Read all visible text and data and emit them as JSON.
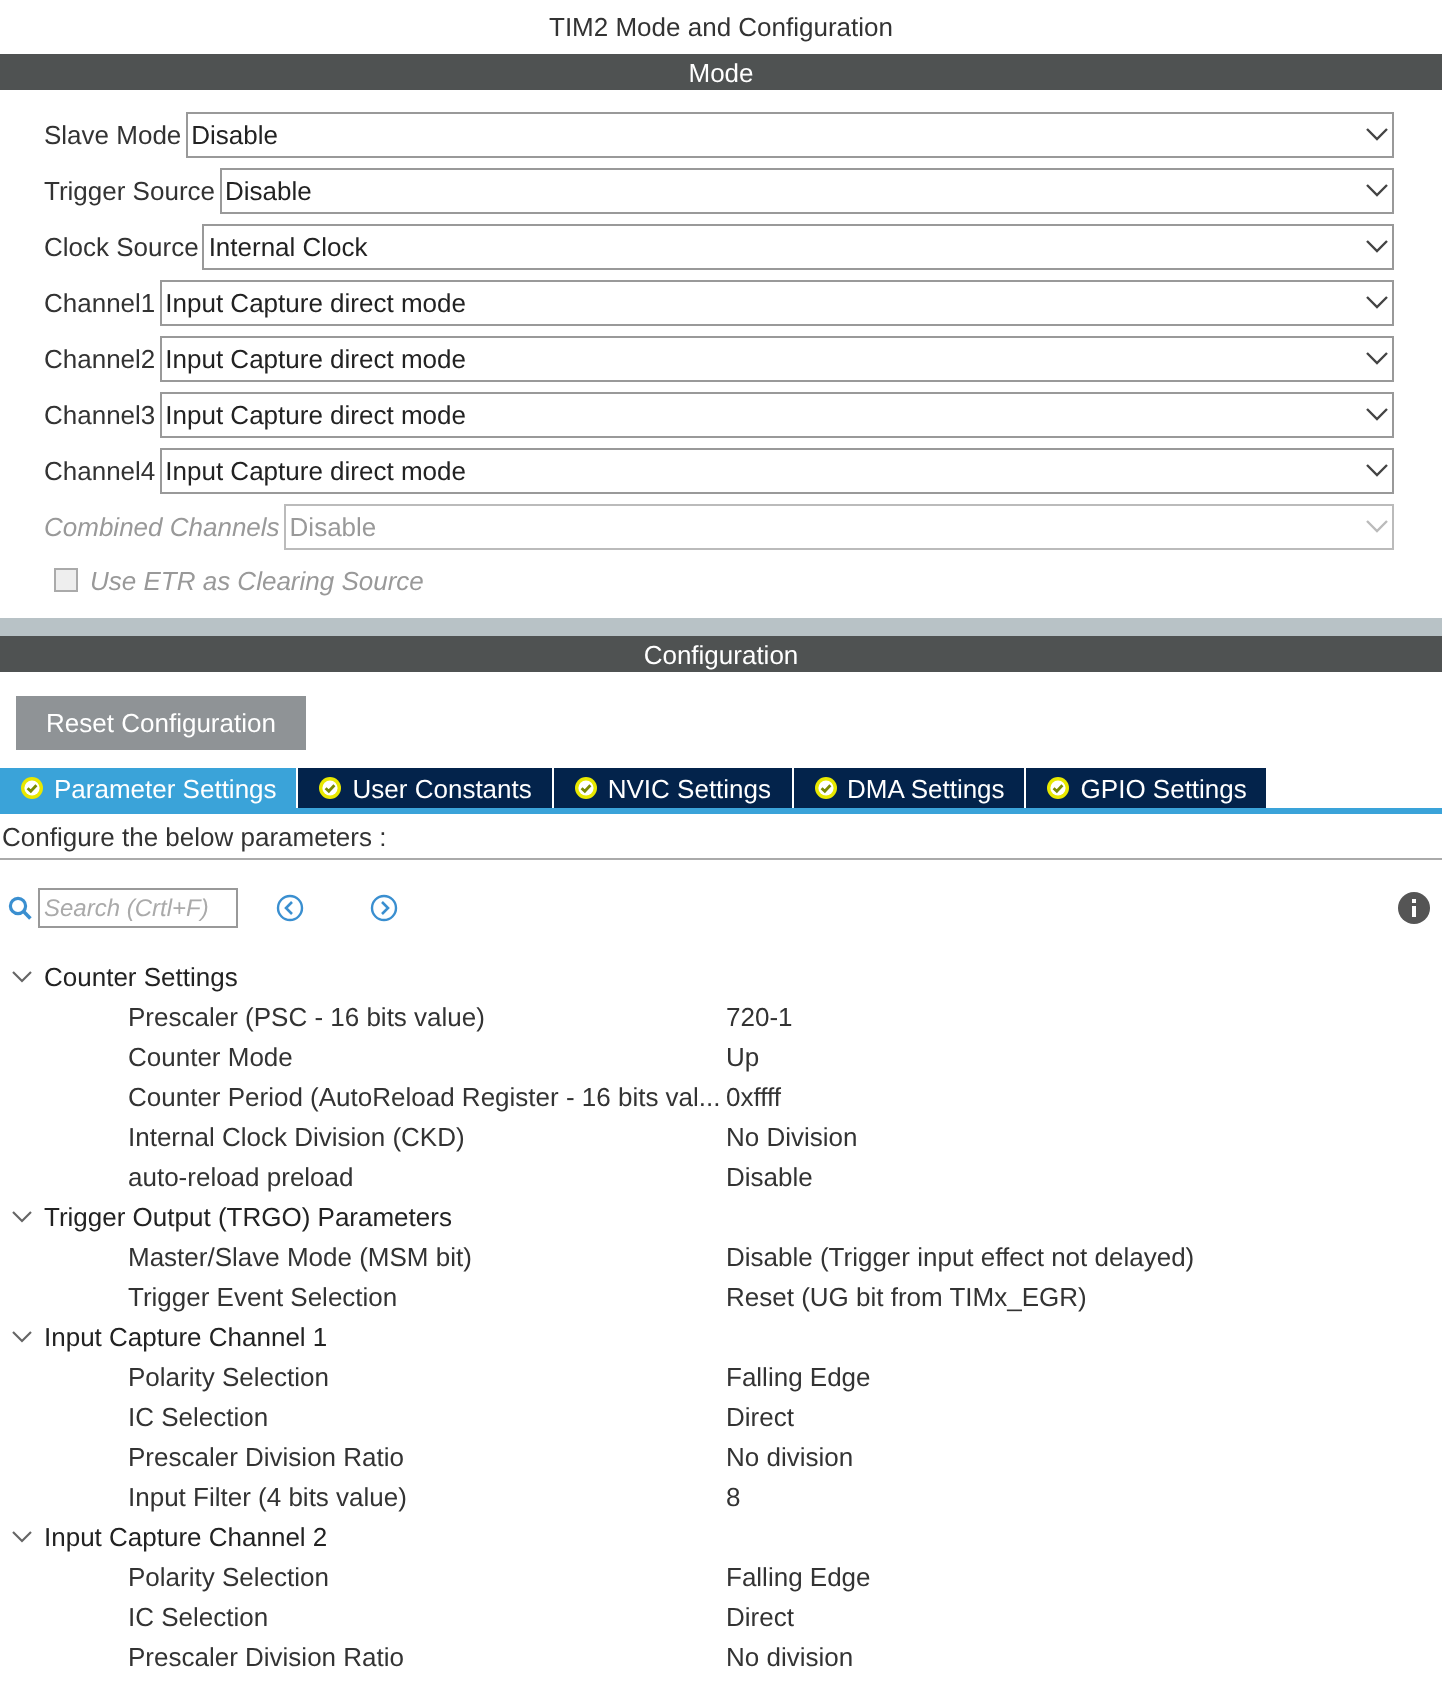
{
  "window": {
    "title": "TIM2 Mode and Configuration"
  },
  "mode": {
    "header": "Mode",
    "fields": [
      {
        "label": "Slave Mode",
        "value": "Disable",
        "disabled": false
      },
      {
        "label": "Trigger Source",
        "value": "Disable",
        "disabled": false
      },
      {
        "label": "Clock Source",
        "value": "Internal Clock",
        "disabled": false
      },
      {
        "label": "Channel1",
        "value": "Input Capture direct mode",
        "disabled": false
      },
      {
        "label": "Channel2",
        "value": "Input Capture direct mode",
        "disabled": false
      },
      {
        "label": "Channel3",
        "value": "Input Capture direct mode",
        "disabled": false
      },
      {
        "label": "Channel4",
        "value": "Input Capture direct mode",
        "disabled": false
      },
      {
        "label": "Combined Channels",
        "value": "Disable",
        "disabled": true
      }
    ],
    "checkbox": {
      "label": "Use ETR as Clearing Source",
      "checked": false,
      "disabled": true
    }
  },
  "configuration": {
    "header": "Configuration",
    "reset_button": "Reset Configuration",
    "tabs": [
      {
        "label": "Parameter Settings",
        "selected": true
      },
      {
        "label": "User Constants",
        "selected": false
      },
      {
        "label": "NVIC Settings",
        "selected": false
      },
      {
        "label": "DMA Settings",
        "selected": false
      },
      {
        "label": "GPIO Settings",
        "selected": false
      }
    ],
    "hint": "Configure the below parameters :",
    "search": {
      "placeholder": "Search (Crtl+F)"
    },
    "tree": [
      {
        "label": "Counter Settings",
        "expanded": true,
        "children": [
          {
            "name": "Prescaler (PSC - 16 bits value)",
            "value": "720-1"
          },
          {
            "name": "Counter Mode",
            "value": "Up"
          },
          {
            "name": "Counter Period (AutoReload Register - 16 bits val...",
            "value": "0xffff"
          },
          {
            "name": "Internal Clock Division (CKD)",
            "value": "No Division"
          },
          {
            "name": "auto-reload preload",
            "value": "Disable"
          }
        ]
      },
      {
        "label": "Trigger Output (TRGO) Parameters",
        "expanded": true,
        "children": [
          {
            "name": "Master/Slave Mode (MSM bit)",
            "value": "Disable (Trigger input effect not delayed)"
          },
          {
            "name": "Trigger Event Selection",
            "value": "Reset (UG bit from TIMx_EGR)"
          }
        ]
      },
      {
        "label": "Input Capture Channel 1",
        "expanded": true,
        "children": [
          {
            "name": "Polarity Selection",
            "value": "Falling Edge"
          },
          {
            "name": "IC Selection",
            "value": "Direct"
          },
          {
            "name": "Prescaler Division Ratio",
            "value": "No division"
          },
          {
            "name": "Input Filter (4 bits value)",
            "value": "8"
          }
        ]
      },
      {
        "label": "Input Capture Channel 2",
        "expanded": true,
        "children": [
          {
            "name": "Polarity Selection",
            "value": "Falling Edge"
          },
          {
            "name": "IC Selection",
            "value": "Direct"
          },
          {
            "name": "Prescaler Division Ratio",
            "value": "No division"
          }
        ]
      }
    ]
  }
}
